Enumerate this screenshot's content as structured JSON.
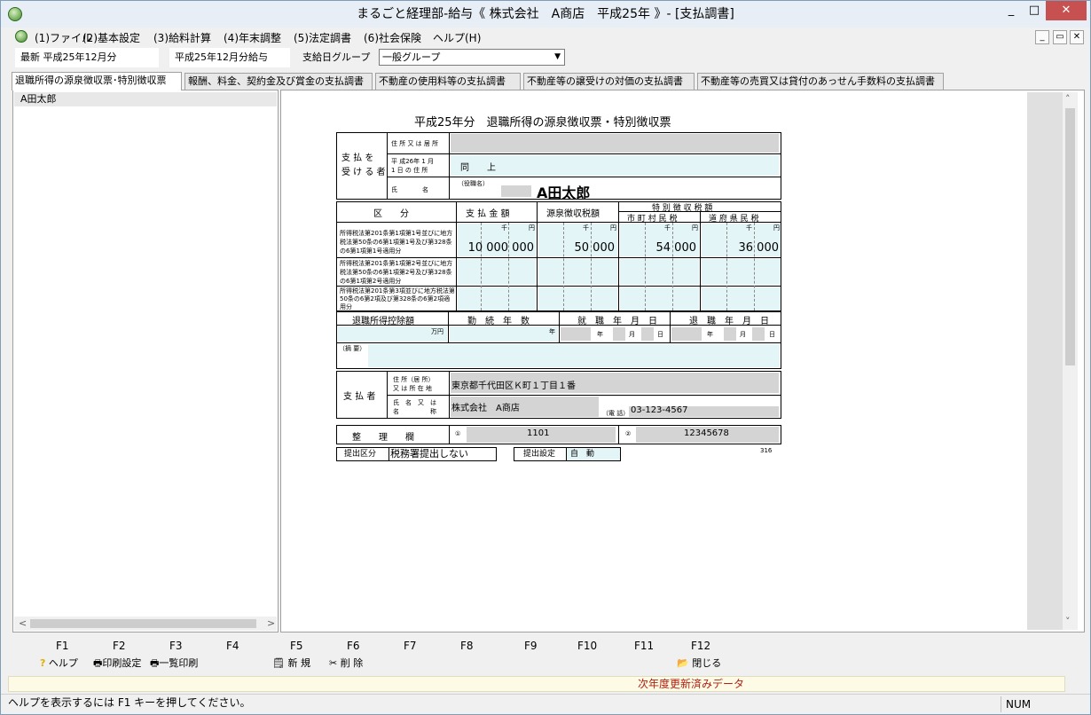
{
  "window": {
    "title": "まるごと経理部-給与《 株式会社　A商店　平成25年 》- [支払調書]",
    "min": "_",
    "max": "□",
    "close": "✕"
  },
  "menu": [
    "(1)ファイル",
    "(2)基本設定",
    "(3)給料計算",
    "(4)年末調整",
    "(5)法定調書",
    "(6)社会保険",
    "ヘルプ(H)"
  ],
  "mdi_buttons": [
    "_",
    "▭",
    "✕"
  ],
  "info": {
    "latest": "最新 平成25年12月分",
    "payroll": "平成25年12月分給与",
    "group_label": "支給日グループ",
    "group_value": "一般グループ"
  },
  "tabs": [
    "退職所得の源泉徴収票･特別徴収票",
    "報酬、料金、契約金及び賞金の支払調書",
    "不動産の使用料等の支払調書",
    "不動産等の譲受けの対価の支払調書",
    "不動産等の売買又は貸付のあっせん手数料の支払調書"
  ],
  "employees": [
    "A田太郎"
  ],
  "form": {
    "title": "平成25年分　退職所得の源泉徴収票・特別徴収票",
    "recipient_label": "支 払 を\n受 け る 者",
    "addr_label": "住 所 又 は 居 所",
    "jan1_label": "平 成26年 1 月\n1 日 の 住 所",
    "jan1_value": "同　　上",
    "name_label": "氏　　　　名",
    "role_label": "（役職名）",
    "name_value": "A田太郎",
    "kubun": "区　　分",
    "payment_header": "支 払 金 額",
    "withholding_header": "源泉徴収税額",
    "special_header": "特 別 徴 収 税 額",
    "city_header": "市 町 村 民 税",
    "pref_header": "道 府 県 民 税",
    "unit_thousand": "千",
    "unit_yen": "円",
    "row1_label": "所得税法第201条第1項第1号並びに地方税法第50条の6第1項第1号及び第328条の6第1項第1号適用分",
    "row2_label": "所得税法第201条第1項第2号並びに地方税法第50条の6第1項第2号及び第328条の6第1項第2号適用分",
    "row3_label": "所得税法第201条第3項並びに地方税法第50条の6第2項及び第328条の6第2項適用分",
    "payment": "10 000 000",
    "withholding": "50 000",
    "city_tax": "54 000",
    "pref_tax": "36 000",
    "deduction_header": "退職所得控除額",
    "years_header": "勤　続　年　数",
    "hire_header": "就　職　年　月　日",
    "retire_header": "退　職　年　月　日",
    "unit_10k": "万円",
    "unit_year": "年",
    "year": "年",
    "month": "月",
    "day": "日",
    "remarks_label": "（摘 要）",
    "payer_label": "支 払 者",
    "payer_addr_label": "住 所（居 所）\n又 は 所 在 地",
    "payer_addr": "東京都千代田区Ｋ町１丁目１番",
    "payer_name_label": "氏　名　又　は\n名　　　　　称",
    "payer_name": "株式会社　A商店",
    "tel_label": "（電 話）",
    "tel": "03-123-4567",
    "seiri_label": "整　　理　　欄",
    "seiri1_mark": "①",
    "seiri1": "1101",
    "seiri2_mark": "②",
    "seiri2": "12345678",
    "form_no": "316",
    "submit_label": "提出区分",
    "submit_value": "税務署提出しない",
    "submit_setting_label": "提出設定",
    "submit_setting_value": "自　動"
  },
  "fkeys": [
    "F1",
    "F2",
    "F3",
    "F4",
    "F5",
    "F6",
    "F7",
    "F8",
    "F9",
    "F10",
    "F11",
    "F12"
  ],
  "factions": {
    "help": "ヘルプ",
    "print_setting": "印刷設定",
    "list_print": "一覧印刷",
    "new": "新 規",
    "delete": "削 除",
    "close": "閉じる"
  },
  "status_notice": "次年度更新済みデータ",
  "status_help": "ヘルプを表示するには F1 キーを押してください。",
  "status_num": "NUM"
}
